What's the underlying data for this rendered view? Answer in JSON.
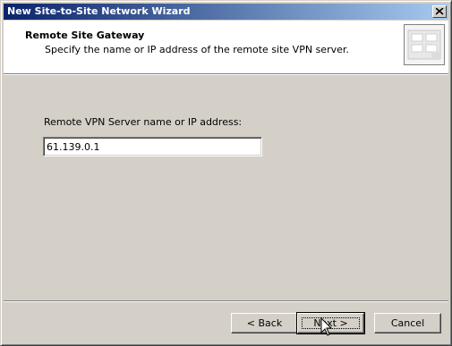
{
  "window": {
    "title": "New Site-to-Site Network Wizard"
  },
  "header": {
    "title": "Remote Site Gateway",
    "subtitle": "Specify the name or IP address of the remote site VPN server."
  },
  "form": {
    "label": "Remote VPN Server name or IP address:",
    "value": "61.139.0.1"
  },
  "buttons": {
    "back": "< Back",
    "next": "Next >",
    "cancel": "Cancel"
  },
  "colors": {
    "titlebar_start": "#0a246a",
    "titlebar_end": "#a6caf0",
    "face": "#d4d0c8"
  },
  "icons": [
    "close-icon",
    "wizard-header-icon",
    "mouse-cursor-icon"
  ]
}
